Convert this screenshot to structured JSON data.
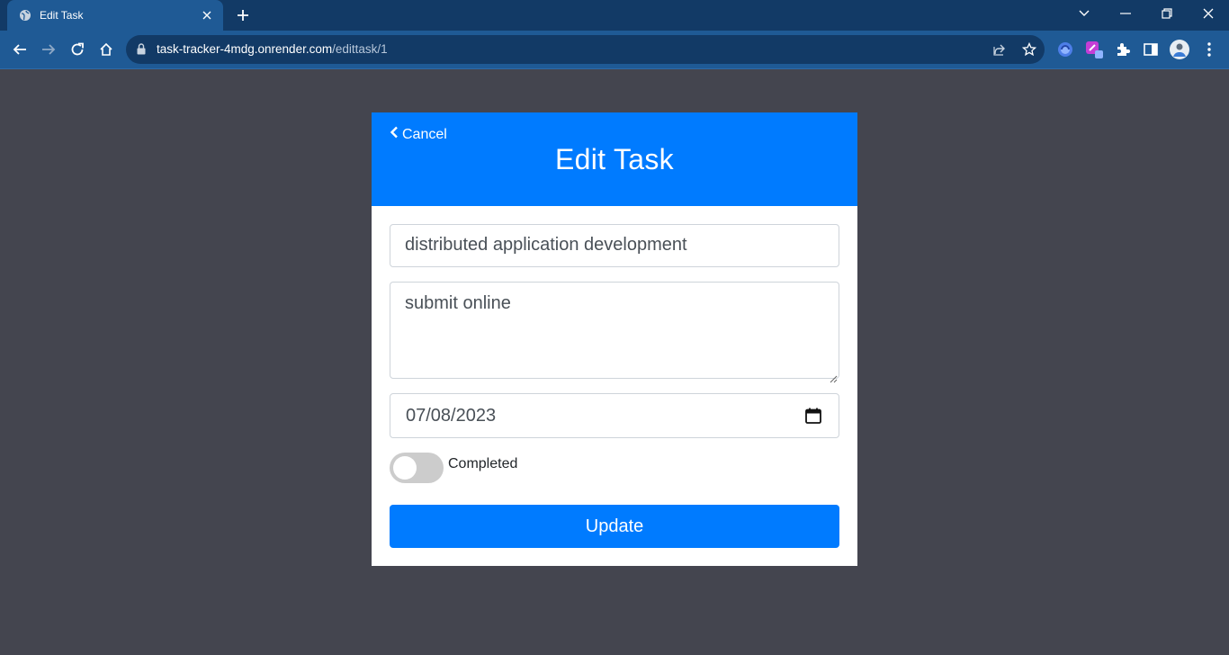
{
  "browser": {
    "tab": {
      "title": "Edit Task",
      "favicon": "globe-icon"
    },
    "address_bar": {
      "host": "task-tracker-4mdg.onrender.com",
      "path": "/edittask/1"
    },
    "icons": [
      "back-icon",
      "forward-icon",
      "reload-icon",
      "home-icon",
      "lock-icon",
      "share-icon",
      "star-icon",
      "extension-icon",
      "puzzle-icon",
      "side-panel-icon",
      "profile-avatar",
      "more-icon"
    ]
  },
  "page": {
    "header": {
      "cancel_label": "Cancel",
      "title": "Edit Task"
    },
    "form": {
      "title_value": "distributed application development",
      "description_value": "submit online",
      "date_value": "07/08/2023",
      "completed_label": "Completed",
      "completed": false,
      "submit_label": "Update"
    }
  },
  "colors": {
    "page_background": "#44454f",
    "accent": "#007bff",
    "browser_frame": "#123a66",
    "browser_toolbar": "#1f5a95"
  }
}
